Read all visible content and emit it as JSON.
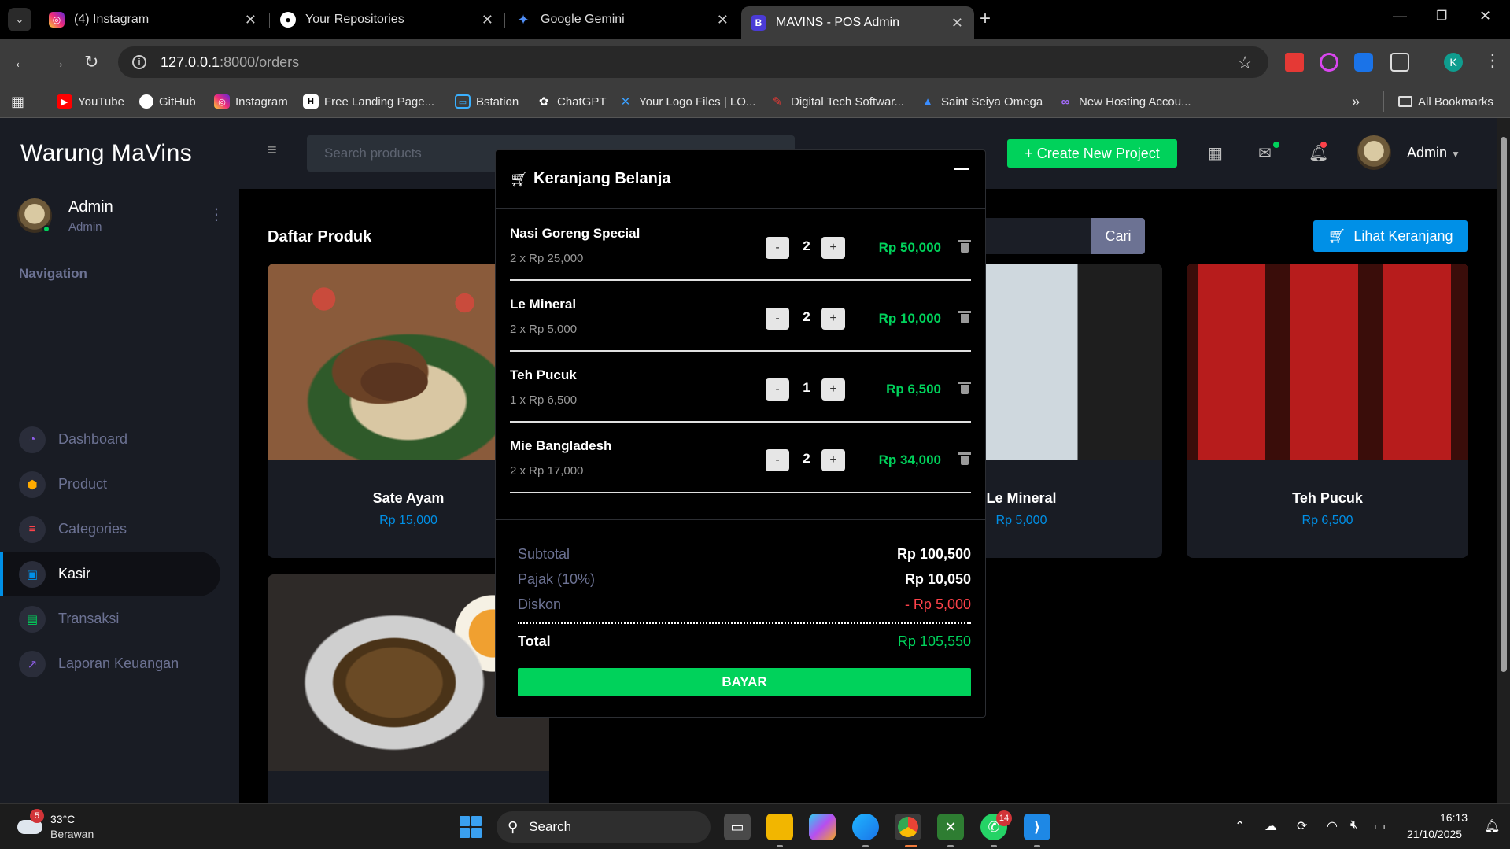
{
  "browser": {
    "tabs": [
      {
        "title": "(4) Instagram",
        "icon": "instagram-icon"
      },
      {
        "title": "Your Repositories",
        "icon": "github-icon"
      },
      {
        "title": "Google Gemini",
        "icon": "gemini-icon"
      },
      {
        "title": "MAVINS - POS Admin",
        "icon": "bootstrap-icon",
        "active": true
      }
    ],
    "url_host": "127.0.0.1",
    "url_path": ":8000/orders",
    "bookmarks": [
      {
        "label": "YouTube",
        "icon": "youtube-icon"
      },
      {
        "label": "GitHub",
        "icon": "github-icon"
      },
      {
        "label": "Instagram",
        "icon": "instagram-icon"
      },
      {
        "label": "Free Landing Page...",
        "icon": "h-icon"
      },
      {
        "label": "Bstation",
        "icon": "bstation-icon"
      },
      {
        "label": "ChatGPT",
        "icon": "chatgpt-icon"
      },
      {
        "label": "Your Logo Files | LO...",
        "icon": "logo-icon"
      },
      {
        "label": "Digital Tech Softwar...",
        "icon": "digital-icon"
      },
      {
        "label": "Saint Seiya Omega",
        "icon": "seiya-icon"
      },
      {
        "label": "New Hosting Accou...",
        "icon": "hosting-icon"
      }
    ],
    "all_bookmarks": "All Bookmarks",
    "profile_initial": "K"
  },
  "sidebar": {
    "brand": "Warung MaVins",
    "user_name": "Admin",
    "user_role": "Admin",
    "nav_title": "Navigation",
    "items": [
      {
        "label": "Dashboard",
        "icon": "speedometer-icon",
        "color": "#8f5fe8"
      },
      {
        "label": "Product",
        "icon": "cube-icon",
        "color": "#ffab00"
      },
      {
        "label": "Categories",
        "icon": "categories-icon",
        "color": "#fc424a"
      },
      {
        "label": "Kasir",
        "icon": "cash-icon",
        "color": "#0090e7",
        "active": true
      },
      {
        "label": "Transaksi",
        "icon": "receipt-icon",
        "color": "#00d25b"
      },
      {
        "label": "Laporan Keuangan",
        "icon": "chart-icon",
        "color": "#8f5fe8"
      }
    ]
  },
  "topnav": {
    "search_placeholder": "Search products",
    "create_button": "+ Create New Project",
    "user": "Admin"
  },
  "content": {
    "section_title": "Daftar Produk",
    "search_button": "Cari",
    "cart_button": "Lihat Keranjang",
    "products": [
      {
        "name": "Sate Ayam",
        "price": "Rp 15,000"
      },
      {
        "name": "Le Mineral",
        "price": "Rp 5,000"
      },
      {
        "name": "Teh Pucuk",
        "price": "Rp 6,500"
      },
      {
        "name": "",
        "price": ""
      }
    ]
  },
  "cart": {
    "title": "Keranjang Belanja",
    "items": [
      {
        "name": "Nasi Goreng Special",
        "detail": "2 x Rp 25,000",
        "qty": "2",
        "total": "Rp 50,000"
      },
      {
        "name": "Le Mineral",
        "detail": "2 x Rp 5,000",
        "qty": "2",
        "total": "Rp 10,000"
      },
      {
        "name": "Teh Pucuk",
        "detail": "1 x Rp 6,500",
        "qty": "1",
        "total": "Rp 6,500"
      },
      {
        "name": "Mie Bangladesh",
        "detail": "2 x Rp 17,000",
        "qty": "2",
        "total": "Rp 34,000"
      }
    ],
    "minus": "-",
    "plus": "+",
    "subtotal_label": "Subtotal",
    "subtotal": "Rp 100,500",
    "tax_label": "Pajak (10%)",
    "tax": "Rp 10,050",
    "discount_label": "Diskon",
    "discount": "- Rp 5,000",
    "total_label": "Total",
    "total": "Rp 105,550",
    "pay_button": "BAYAR",
    "colors": {
      "positive": "#00d25b",
      "negative": "#fc424a"
    }
  },
  "taskbar": {
    "weather_badge": "5",
    "temperature": "33°C",
    "weather": "Berawan",
    "search": "Search",
    "whatsapp_badge": "14",
    "time": "16:13",
    "date": "21/10/2025"
  }
}
